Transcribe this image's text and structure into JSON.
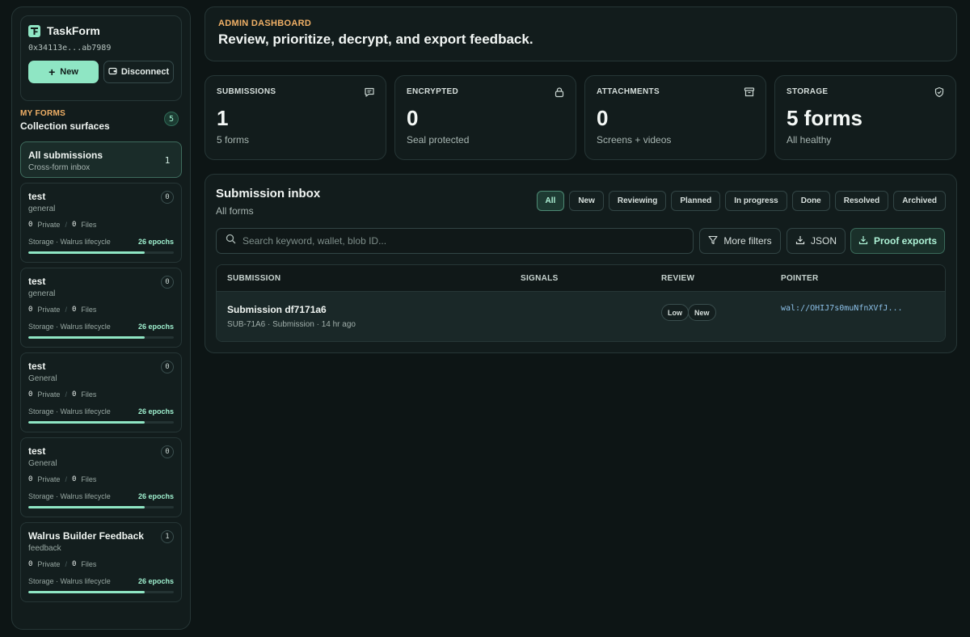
{
  "brand": {
    "name": "TaskForm",
    "address": "0x34113e...ab7989",
    "new_label": "New",
    "disconnect_label": "Disconnect"
  },
  "my_forms": {
    "label": "MY FORMS",
    "title": "Collection surfaces",
    "count": "5",
    "all": {
      "title": "All submissions",
      "subtitle": "Cross-form inbox",
      "count": "1"
    },
    "items": [
      {
        "title": "test",
        "category": "general",
        "count": "0",
        "private": "0",
        "private_label": "Private",
        "files": "0",
        "files_label": "Files",
        "storage_label": "Storage · Walrus lifecycle",
        "epochs": "26 epochs",
        "progress": 0.8
      },
      {
        "title": "test",
        "category": "general",
        "count": "0",
        "private": "0",
        "private_label": "Private",
        "files": "0",
        "files_label": "Files",
        "storage_label": "Storage · Walrus lifecycle",
        "epochs": "26 epochs",
        "progress": 0.8
      },
      {
        "title": "test",
        "category": "General",
        "count": "0",
        "private": "0",
        "private_label": "Private",
        "files": "0",
        "files_label": "Files",
        "storage_label": "Storage · Walrus lifecycle",
        "epochs": "26 epochs",
        "progress": 0.8
      },
      {
        "title": "test",
        "category": "General",
        "count": "0",
        "private": "0",
        "private_label": "Private",
        "files": "0",
        "files_label": "Files",
        "storage_label": "Storage · Walrus lifecycle",
        "epochs": "26 epochs",
        "progress": 0.8
      },
      {
        "title": "Walrus Builder Feedback",
        "category": "feedback",
        "count": "1",
        "private": "0",
        "private_label": "Private",
        "files": "0",
        "files_label": "Files",
        "storage_label": "Storage · Walrus lifecycle",
        "epochs": "26 epochs",
        "progress": 0.8
      }
    ]
  },
  "header": {
    "kicker": "ADMIN DASHBOARD",
    "title": "Review, prioritize, decrypt, and export feedback."
  },
  "stats": [
    {
      "label": "SUBMISSIONS",
      "value": "1",
      "sub": "5 forms",
      "icon": "message-icon"
    },
    {
      "label": "ENCRYPTED",
      "value": "0",
      "sub": "Seal protected",
      "icon": "lock-icon"
    },
    {
      "label": "ATTACHMENTS",
      "value": "0",
      "sub": "Screens + videos",
      "icon": "archive-icon"
    },
    {
      "label": "STORAGE",
      "value": "5 forms",
      "sub": "All healthy",
      "icon": "shield-check-icon"
    }
  ],
  "inbox": {
    "title": "Submission inbox",
    "subtitle": "All forms",
    "filters": [
      "All",
      "New",
      "Reviewing",
      "Planned",
      "In progress",
      "Done",
      "Resolved",
      "Archived"
    ],
    "active_filter": "All",
    "search_placeholder": "Search keyword, wallet, blob ID...",
    "more_filters_label": "More filters",
    "json_label": "JSON",
    "proof_exports_label": "Proof exports",
    "columns": [
      "SUBMISSION",
      "SIGNALS",
      "REVIEW",
      "POINTER"
    ],
    "rows": [
      {
        "title": "Submission df7171a6",
        "meta": "SUB-71A6 · Submission · 14 hr ago",
        "review": [
          "Low",
          "New"
        ],
        "pointer": "wal://OHIJ7s0muNfnXVfJ..."
      }
    ]
  },
  "colors": {
    "accent": "#8fe6c4",
    "kicker": "#f0b066",
    "background": "#0d1515"
  }
}
